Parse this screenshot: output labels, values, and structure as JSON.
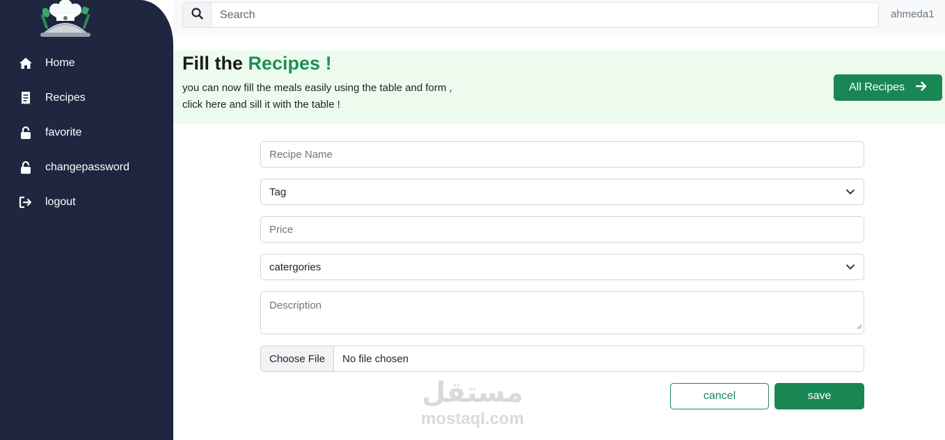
{
  "sidebar": {
    "logo_icon": "chef-logo-icon",
    "items": [
      {
        "label": "Home",
        "icon": "home-icon"
      },
      {
        "label": "Recipes",
        "icon": "receipt-icon"
      },
      {
        "label": "favorite",
        "icon": "unlock-icon"
      },
      {
        "label": "changepassword",
        "icon": "unlock-icon"
      },
      {
        "label": "logout",
        "icon": "logout-icon"
      }
    ]
  },
  "topbar": {
    "search_placeholder": "Search",
    "username": "ahmeda1"
  },
  "banner": {
    "title_prefix": "Fill the",
    "title_accent": "Recipes !",
    "line1": "you can now fill the meals easily using the table and form ,",
    "line2": "click here and sill it with the table !",
    "button_label": "All Recipes"
  },
  "form": {
    "recipe_name_placeholder": "Recipe Name",
    "tag_selected": "Tag",
    "price_placeholder": "Price",
    "categories_selected": "catergories",
    "description_placeholder": "Description",
    "file_button": "Choose File",
    "file_status": "No file chosen",
    "cancel_label": "cancel",
    "save_label": "save"
  },
  "watermark": {
    "arabic": "مستقل",
    "latin": "mostaql.com"
  },
  "colors": {
    "sidebar_bg": "#1f2640",
    "accent_green": "#198754",
    "banner_bg": "#edfbef"
  }
}
